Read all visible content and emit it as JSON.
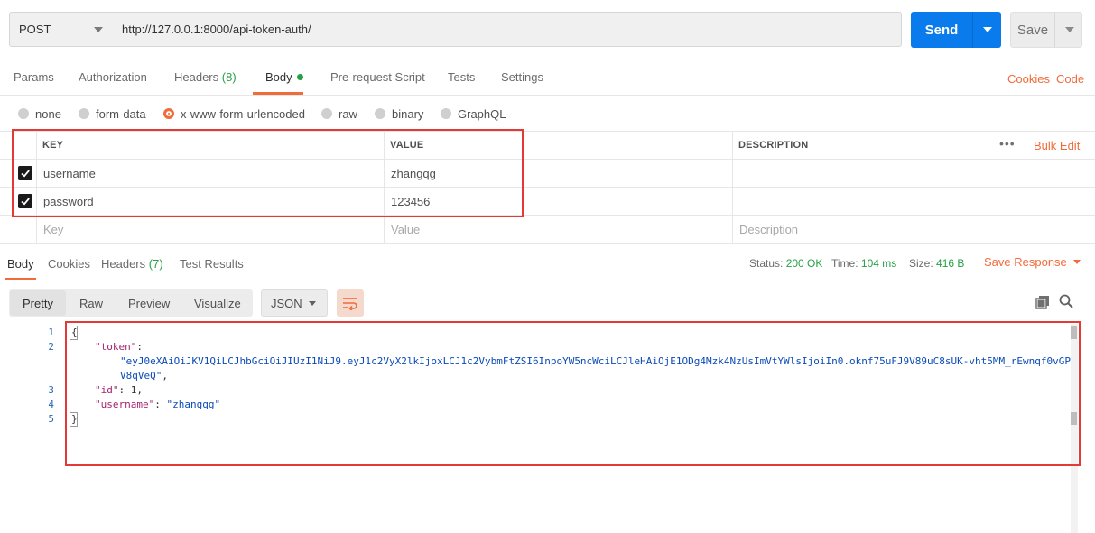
{
  "request": {
    "method": "POST",
    "url": "http://127.0.0.1:8000/api-token-auth/",
    "send_label": "Send",
    "save_label": "Save"
  },
  "request_tabs": {
    "params": "Params",
    "authorization": "Authorization",
    "headers": "Headers",
    "headers_count": "(8)",
    "body": "Body",
    "prerequest": "Pre-request Script",
    "tests": "Tests",
    "settings": "Settings",
    "cookies": "Cookies",
    "code": "Code"
  },
  "body_types": {
    "none": "none",
    "form_data": "form-data",
    "urlencoded": "x-www-form-urlencoded",
    "raw": "raw",
    "binary": "binary",
    "graphql": "GraphQL",
    "selected": "x-www-form-urlencoded"
  },
  "params_table": {
    "headers": {
      "key": "KEY",
      "value": "VALUE",
      "description": "DESCRIPTION",
      "bulk_edit": "Bulk Edit"
    },
    "rows": [
      {
        "key": "username",
        "value": "zhangqg",
        "checked": true
      },
      {
        "key": "password",
        "value": "123456",
        "checked": true
      }
    ],
    "placeholders": {
      "key": "Key",
      "value": "Value",
      "description": "Description"
    }
  },
  "response": {
    "tabs": {
      "body": "Body",
      "cookies": "Cookies",
      "headers": "Headers",
      "headers_count": "(7)",
      "test_results": "Test Results"
    },
    "status_label": "Status:",
    "status_value": "200 OK",
    "time_label": "Time:",
    "time_value": "104 ms",
    "size_label": "Size:",
    "size_value": "416 B",
    "save_response": "Save Response",
    "formats": {
      "pretty": "Pretty",
      "raw": "Raw",
      "preview": "Preview",
      "visualize": "Visualize"
    },
    "language": "JSON",
    "line_numbers": [
      "1",
      "2",
      "3",
      "4",
      "5"
    ],
    "json": {
      "open": "{",
      "token_key": "\"token\"",
      "token_value_1": "\"eyJ0eXAiOiJKV1QiLCJhbGciOiJIUzI1NiJ9.eyJ1c2VyX2lkIjoxLCJ1c2VybmFtZSI6InpoYW5ncWciLCJleHAiOjE1ODg4Mzk4NzUsImVtYWlsIjoiIn0.oknf75uFJ9V89uC8sUK-vht5MM_rEwnqf0vGP",
      "token_value_2": "V8qVeQ\"",
      "id_key": "\"id\"",
      "id_value": "1",
      "username_key": "\"username\"",
      "username_value": "\"zhangqg\"",
      "close": "}"
    }
  },
  "colors": {
    "accent": "#f26b3a",
    "send": "#097bed",
    "success": "#26a045",
    "highlight_box": "#e53935"
  }
}
